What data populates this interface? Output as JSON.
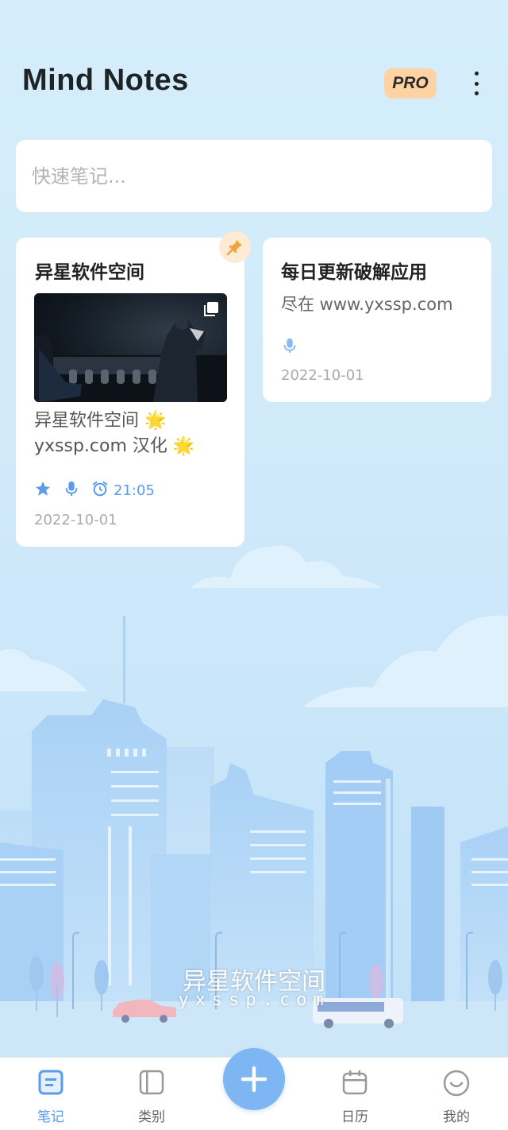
{
  "app": {
    "title": "Mind Notes",
    "pro_label": "PRO"
  },
  "quick_note": {
    "placeholder": "快速笔记..."
  },
  "notes": [
    {
      "title": "异星软件空间",
      "pinned": true,
      "has_image": true,
      "body_line1": "异星软件空间 🌟",
      "body_line2": "yxssp.com 汉化 🌟",
      "starred": true,
      "has_audio": true,
      "reminder_time": "21:05",
      "date": "2022-10-01"
    },
    {
      "title": "每日更新破解应用",
      "body": "尽在 www.yxssp.com",
      "has_audio": true,
      "date": "2022-10-01"
    }
  ],
  "watermark": {
    "line1": "异星软件空间",
    "line2": "yxssp.com"
  },
  "nav": {
    "notes": "笔记",
    "categories": "类别",
    "calendar": "日历",
    "mine": "我的"
  },
  "colors": {
    "accent": "#5b9bea",
    "fab": "#7db6f3",
    "pro_badge": "#fdd3a4",
    "pin": "#f5a23c"
  }
}
